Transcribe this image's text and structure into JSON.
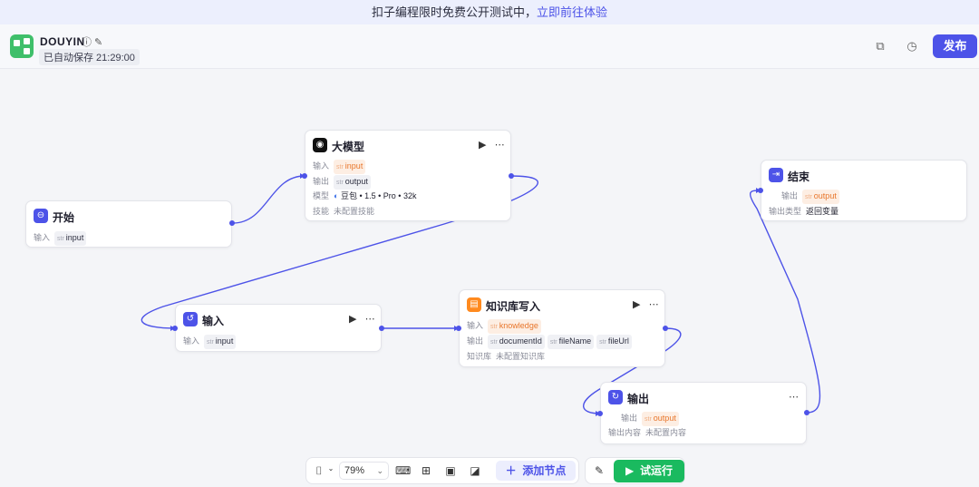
{
  "banner": {
    "text": "扣子编程限时免费公开测试中，",
    "link": "立即前往体验"
  },
  "header": {
    "app_name": "DOUYIN",
    "autosave": "已自动保存 21:29:00",
    "publish_label": "发布",
    "info_icon": "info-icon",
    "edit_icon": "edit-icon",
    "copy_icon": "copy-icon",
    "history_icon": "history-icon"
  },
  "nodes": {
    "start": {
      "title": "开始",
      "input_label": "输入",
      "param": "input",
      "str": "str"
    },
    "llm": {
      "title": "大模型",
      "input_label": "输入",
      "input_param": "input",
      "output_label": "输出",
      "output_param": "output",
      "model_label": "模型",
      "model_value": "豆包 • 1.5 • Pro • 32k",
      "skill_label": "技能",
      "skill_value": "未配置技能",
      "str": "str"
    },
    "input": {
      "title": "输入",
      "input_label": "输入",
      "param": "input",
      "str": "str"
    },
    "kb_write": {
      "title": "知识库写入",
      "input_label": "输入",
      "input_param": "knowledge",
      "output_label": "输出",
      "out1": "documentId",
      "out2": "fileName",
      "out3": "fileUrl",
      "kb_label": "知识库",
      "kb_value": "未配置知识库",
      "str": "str"
    },
    "output": {
      "title": "输出",
      "output_label": "输出",
      "output_param": "output",
      "content_label": "输出内容",
      "content_value": "未配置内容",
      "str": "str"
    },
    "end": {
      "title": "结束",
      "output_label": "输出",
      "output_param": "output",
      "type_label": "输出类型",
      "type_value": "返回变量",
      "str": "str"
    }
  },
  "toolbar": {
    "zoom": "79%",
    "add_node_label": "添加节点",
    "run_label": "试运行",
    "run_icon": "play-icon"
  },
  "colors": {
    "accent": "#4d53e8",
    "run": "#1aba5f",
    "brand": "#3fbf6a",
    "kb_icon": "#ff8a1f"
  }
}
